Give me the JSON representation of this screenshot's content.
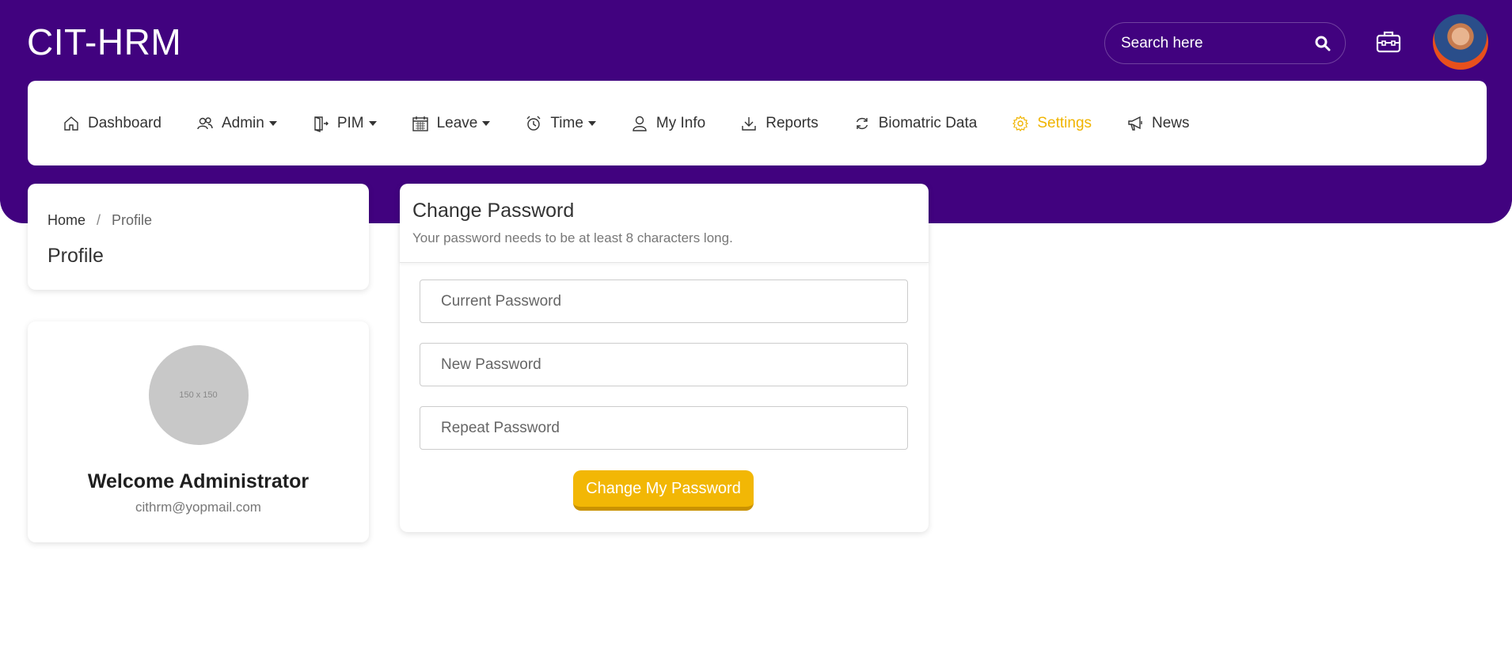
{
  "app": {
    "brand": "CIT-HRM"
  },
  "header": {
    "search_placeholder": "Search here"
  },
  "nav": {
    "items": [
      {
        "label": "Dashboard",
        "icon": "home-icon",
        "dropdown": false,
        "active": false
      },
      {
        "label": "Admin",
        "icon": "users-icon",
        "dropdown": true,
        "active": false
      },
      {
        "label": "PIM",
        "icon": "door-icon",
        "dropdown": true,
        "active": false
      },
      {
        "label": "Leave",
        "icon": "calendar-icon",
        "dropdown": true,
        "active": false
      },
      {
        "label": "Time",
        "icon": "alarm-clock-icon",
        "dropdown": true,
        "active": false
      },
      {
        "label": "My Info",
        "icon": "person-icon",
        "dropdown": false,
        "active": false
      },
      {
        "label": "Reports",
        "icon": "download-icon",
        "dropdown": false,
        "active": false
      },
      {
        "label": "Biomatric Data",
        "icon": "refresh-icon",
        "dropdown": false,
        "active": false
      },
      {
        "label": "Settings",
        "icon": "gear-icon",
        "dropdown": false,
        "active": true
      },
      {
        "label": "News",
        "icon": "megaphone-icon",
        "dropdown": false,
        "active": false
      }
    ]
  },
  "breadcrumb": {
    "home": "Home",
    "separator": "/",
    "current": "Profile",
    "page_title": "Profile"
  },
  "profile": {
    "image_placeholder": "150 x 150",
    "welcome": "Welcome Administrator",
    "email": "cithrm@yopmail.com"
  },
  "change_password": {
    "title": "Change Password",
    "subtitle": "Your password needs to be at least 8 characters long.",
    "current_placeholder": "Current Password",
    "new_placeholder": "New Password",
    "repeat_placeholder": "Repeat Password",
    "button": "Change My Password"
  },
  "colors": {
    "brand": "#41027f",
    "accent": "#f2b705",
    "active_nav": "#f0b400"
  }
}
